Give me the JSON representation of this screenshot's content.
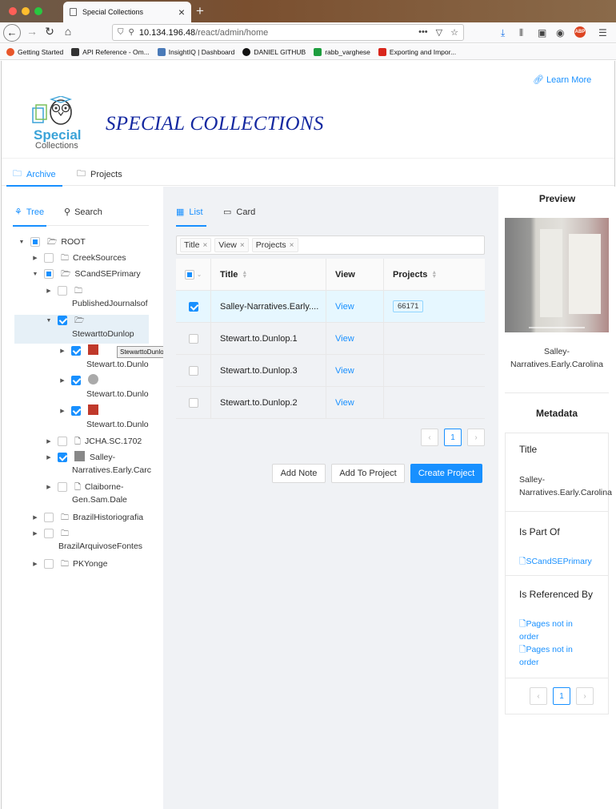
{
  "browser": {
    "tab_title": "Special Collections",
    "url_host": "10.134.196.48",
    "url_path": "/react/admin/home",
    "bookmarks": [
      {
        "label": "Getting Started",
        "color": "#e8562a"
      },
      {
        "label": "API Reference - Om...",
        "color": "#333333"
      },
      {
        "label": "InsightIQ | Dashboard",
        "color": "#4a7ab8"
      },
      {
        "label": "DANIEL GITHUB",
        "color": "#111111"
      },
      {
        "label": "rabb_varghese",
        "color": "#1e9e3f"
      },
      {
        "label": "Exporting and Impor...",
        "color": "#d9261c"
      }
    ],
    "abp_label": "ABP"
  },
  "header": {
    "learn_more": "Learn More",
    "logo_line1": "Special",
    "logo_line2": "Collections",
    "title": "SPECIAL COLLECTIONS"
  },
  "main_tabs": [
    {
      "label": "Archive",
      "active": true
    },
    {
      "label": "Projects",
      "active": false
    }
  ],
  "tree_panel": {
    "tabs": [
      "Tree",
      "Search"
    ],
    "nodes": {
      "root": "ROOT",
      "creek": "CreekSources",
      "scand": "SCandSEPrimary",
      "published": "PublishedJournalsof",
      "stewart": "StewarttoDunlop",
      "stewart_child1": "Stewart.to.Dunlo",
      "stewart_child2": "Stewart.to.Dunlo",
      "stewart_child3": "Stewart.to.Dunlo",
      "jcha": "JCHA.SC.1702",
      "salley1": "Salley-",
      "salley2": "Narratives.Early.Carc",
      "claiborne1": "Claiborne-",
      "claiborne2": "Gen.Sam.Dale",
      "brazilhist": "BrazilHistoriografia",
      "brazilarq": "BrazilArquivoseFontes",
      "pkyonge": "PKYonge"
    },
    "tooltip": "StewarttoDunlop"
  },
  "list_panel": {
    "tabs": [
      "List",
      "Card"
    ],
    "filters": [
      "Title",
      "View",
      "Projects"
    ],
    "columns": {
      "title": "Title",
      "view": "View",
      "projects": "Projects"
    },
    "rows": [
      {
        "title": "Salley-Narratives.Early....",
        "view": "View",
        "project": "66171",
        "checked": true
      },
      {
        "title": "Stewart.to.Dunlop.1",
        "view": "View",
        "project": "",
        "checked": false
      },
      {
        "title": "Stewart.to.Dunlop.3",
        "view": "View",
        "project": "",
        "checked": false
      },
      {
        "title": "Stewart.to.Dunlop.2",
        "view": "View",
        "project": "",
        "checked": false
      }
    ],
    "current_page": "1",
    "buttons": {
      "add_note": "Add Note",
      "add_to_project": "Add To Project",
      "create_project": "Create Project"
    }
  },
  "preview_panel": {
    "title": "Preview",
    "caption": "Salley-Narratives.Early.Carolina",
    "metadata_title": "Metadata",
    "title_label": "Title",
    "title_value": "Salley-Narratives.Early.Carolina",
    "is_part_of_label": "Is Part Of",
    "is_part_of_value": "SCandSEPrimary",
    "referenced_label": "Is Referenced By",
    "referenced_values": [
      "Pages not in order",
      "Pages not in order"
    ],
    "current_page": "1"
  },
  "colors": {
    "accent": "#1890ff",
    "title_blue": "#1428a0",
    "logo_blue": "#3ba3d8"
  }
}
